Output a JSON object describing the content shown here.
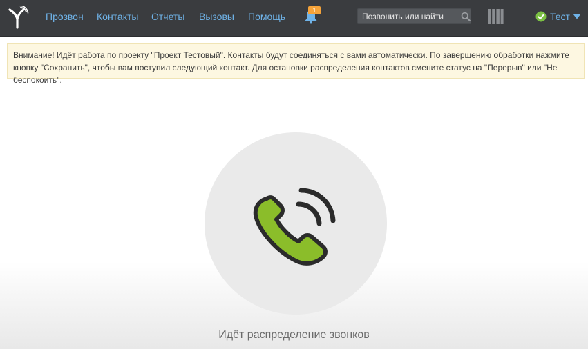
{
  "header": {
    "nav": [
      {
        "label": "Прозвон"
      },
      {
        "label": "Контакты"
      },
      {
        "label": "Отчеты"
      },
      {
        "label": "Вызовы"
      },
      {
        "label": "Помощь"
      }
    ],
    "notifications": {
      "count": "1"
    },
    "search": {
      "placeholder": "Позвонить или найти"
    },
    "user": {
      "name": "Тест",
      "status": "online"
    }
  },
  "alert": {
    "text": "Внимание! Идёт работа по проекту \"Проект Тестовый\". Контакты будут соединяться с вами автоматически. По завершению обработки нажмите кнопку \"Сохранить\", чтобы вам поступил следующий контакт. Для остановки распределения контактов смените статус на \"Перерыв\" или \"Не беспокоить\"."
  },
  "main": {
    "status_text": "Идёт распределение звонков"
  },
  "colors": {
    "topbar": "#3a3c3f",
    "link": "#6fb3e8",
    "badge": "#f5a33a",
    "phone_green": "#8bbd2a",
    "status_green": "#7bc043"
  },
  "icons": [
    "logo-icon",
    "bell-icon",
    "search-icon",
    "grid-icon",
    "status-check-icon",
    "chevron-down-icon",
    "phone-ringing-icon"
  ]
}
